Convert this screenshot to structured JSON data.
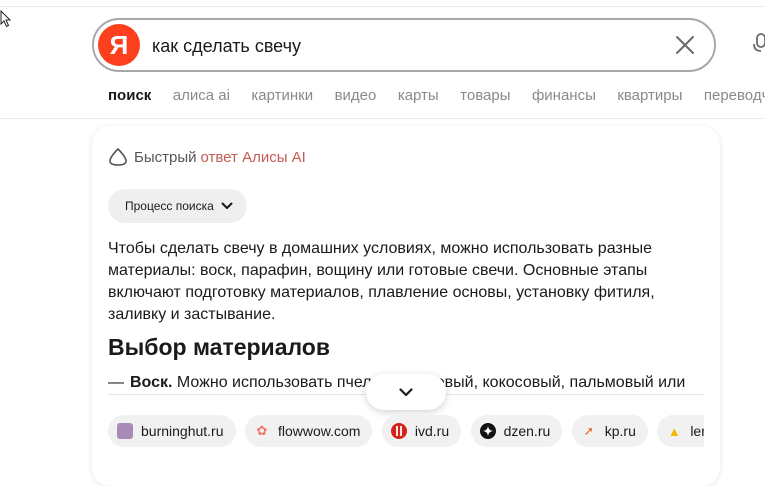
{
  "search": {
    "logo": "Я",
    "query": "как сделать свечу"
  },
  "tabs": [
    {
      "label": "поиск",
      "active": true
    },
    {
      "label": "алиса ai",
      "active": false
    },
    {
      "label": "картинки",
      "active": false
    },
    {
      "label": "видео",
      "active": false
    },
    {
      "label": "карты",
      "active": false
    },
    {
      "label": "товары",
      "active": false
    },
    {
      "label": "финансы",
      "active": false
    },
    {
      "label": "квартиры",
      "active": false
    },
    {
      "label": "переводчик",
      "active": false
    }
  ],
  "answer": {
    "header_prefix": "Быстрый",
    "header_accent": "ответ Алисы AI",
    "process_button": "Процесс поиска",
    "text": "Чтобы сделать свечу в домашних условиях, можно использовать разные материалы: воск, парафин, вощину или готовые свечи. Основные этапы включают подготовку материалов, плавление основы, установку фитиля, заливку и застывание.",
    "section_title": "Выбор материалов",
    "bullet_dash": "—",
    "bullet_term": "Воск.",
    "bullet_text": "Можно использовать пчелиный, соевый, кокосовый, пальмовый или"
  },
  "sources": [
    {
      "label": "burninghut.ru",
      "icon": "burninghut-favicon"
    },
    {
      "label": "flowwow.com",
      "icon": "flowwow-favicon"
    },
    {
      "label": "ivd.ru",
      "icon": "ivd-favicon"
    },
    {
      "label": "dzen.ru",
      "icon": "dzen-favicon"
    },
    {
      "label": "kp.ru",
      "icon": "kp-favicon"
    },
    {
      "label": "lenta.ru",
      "icon": "lenta-favicon"
    }
  ],
  "colors": {
    "brand_red": "#fc3f1d",
    "alice_accent": "#c35c54",
    "tab_inactive": "#8a8a8a"
  }
}
